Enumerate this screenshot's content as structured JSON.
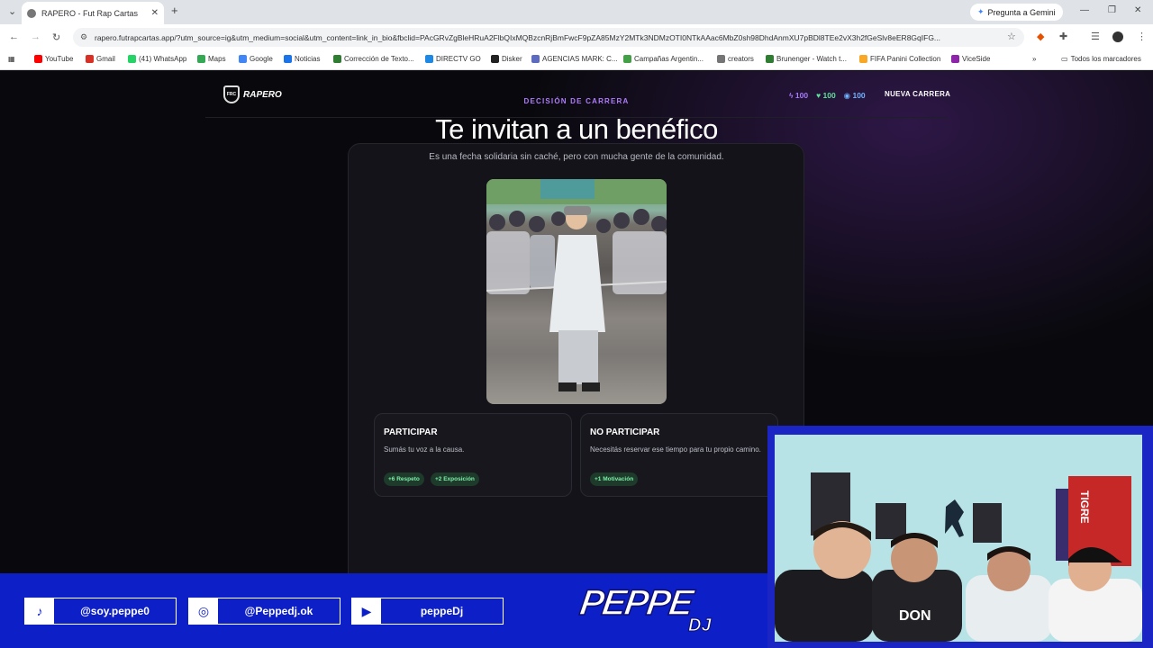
{
  "browser": {
    "tab_title": "RAPERO - Fut Rap Cartas",
    "new_tab": "+",
    "gemini_button": "Pregunta a Gemini",
    "url": "rapero.futrapcartas.app/?utm_source=ig&utm_medium=social&utm_content=link_in_bio&fbclid=PAcGRvZgBleHRuA2FlbQIxMQBzcnRjBmFwcF9pZA85MzY2MTk3NDMzOTI0NTkAAac6MbZ0sh98DhdAnmXU7pBDl8TEe2vX3h2fGeSlv8eER8GqIFG...",
    "bookmarks": [
      {
        "label": "YouTube",
        "color": "#ff0000"
      },
      {
        "label": "Gmail",
        "color": "#d93025"
      },
      {
        "label": "(41) WhatsApp",
        "color": "#25d366"
      },
      {
        "label": "Maps",
        "color": "#34a853"
      },
      {
        "label": "Google",
        "color": "#4285f4"
      },
      {
        "label": "Noticias",
        "color": "#1a73e8"
      },
      {
        "label": "Corrección de Texto...",
        "color": "#2e7d32"
      },
      {
        "label": "DIRECTV GO",
        "color": "#1e88e5"
      },
      {
        "label": "Disker",
        "color": "#222222"
      },
      {
        "label": "AGENCIAS MARK: C...",
        "color": "#5c6bc0"
      },
      {
        "label": "Campañas Argentin...",
        "color": "#43a047"
      },
      {
        "label": "creators",
        "color": "#757575"
      },
      {
        "label": "Brunenger - Watch t...",
        "color": "#2e7d32"
      },
      {
        "label": "FIFA Panini Collection",
        "color": "#f9a825"
      },
      {
        "label": "ViceSide",
        "color": "#8e24aa"
      }
    ],
    "all_bookmarks": "Todos los marcadores"
  },
  "app": {
    "logo_text": "RAPERO",
    "logo_badge": "FRC",
    "stats": {
      "flow": "100",
      "respect": "100",
      "exposure": "100"
    },
    "new_career": "NUEVA CARRERA",
    "eyebrow": "DECISIÓN DE CARRERA",
    "title": "Te invitan a un benéfico",
    "subtitle": "Es una fecha solidaria sin caché, pero con mucha gente de la comunidad.",
    "options": [
      {
        "title": "PARTICIPAR",
        "desc": "Sumás tu voz a la causa.",
        "effects": [
          "+6 Respeto",
          "+2 Exposición"
        ]
      },
      {
        "title": "NO PARTICIPAR",
        "desc": "Necesitás reservar ese tiempo para tu propio camino.",
        "effects": [
          "+1 Motivación"
        ]
      }
    ]
  },
  "overlay": {
    "socials": [
      {
        "icon": "tiktok-icon",
        "glyph": "♪",
        "handle": "@soy.peppe0"
      },
      {
        "icon": "instagram-icon",
        "glyph": "◎",
        "handle": "@Peppedj.ok"
      },
      {
        "icon": "youtube-icon",
        "glyph": "▶",
        "handle": "peppeDj"
      }
    ],
    "brand_main": "PEPPE",
    "brand_sub": "DJ",
    "webcam_banner": "TIGRE"
  }
}
